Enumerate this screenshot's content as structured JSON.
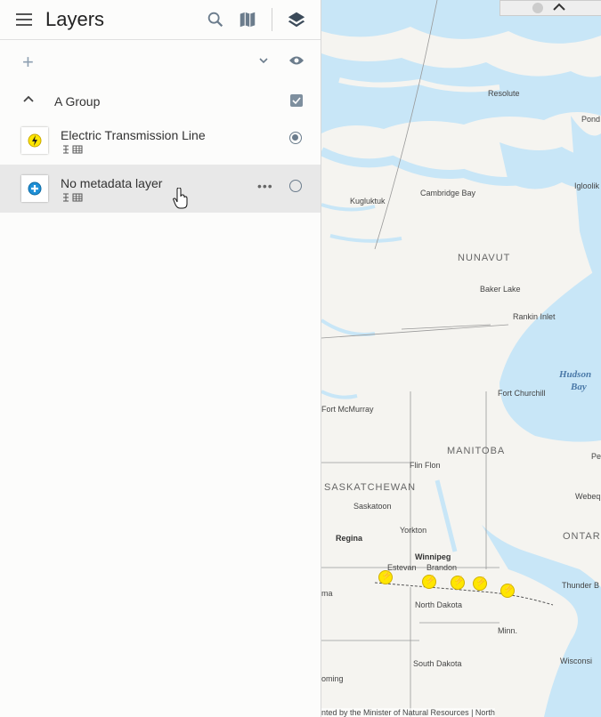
{
  "panel": {
    "title": "Layers",
    "group": {
      "label": "A Group"
    },
    "layers": [
      {
        "name": "Electric Transmission Line",
        "selected": true
      },
      {
        "name": "No metadata layer",
        "selected": false
      }
    ]
  },
  "map": {
    "places": {
      "resolute": "Resolute",
      "pond": "Pond",
      "igloolik": "Igloolik",
      "cambridge_bay": "Cambridge Bay",
      "kugluktuk": "Kugluktuk",
      "baker_lake": "Baker Lake",
      "rankin_inlet": "Rankin Inlet",
      "fort_churchill": "Fort Churchill",
      "fort_mcmurray": "Fort McMurray",
      "flin_flon": "Flin Flon",
      "saskatoon": "Saskatoon",
      "yorkton": "Yorkton",
      "regina": "Regina",
      "winnipeg": "Winnipeg",
      "estevan": "Estevan",
      "brandon": "Brandon",
      "north_dakota": "North Dakota",
      "minn": "Minn.",
      "south_dakota": "South Dakota",
      "wisconsin": "Wisconsi",
      "webeq": "Webeq",
      "thunder_bay": "Thunder B",
      "pe": "Pe",
      "ma": "ma",
      "oming": "oming"
    },
    "regions": {
      "nunavut": "NUNAVUT",
      "manitoba": "MANITOBA",
      "saskatchewan": "SASKATCHEWAN",
      "ontario": "ONTAR"
    },
    "water": {
      "hudson_bay_1": "Hudson",
      "hudson_bay_2": "Bay"
    },
    "attribution": "nted by the Minister of Natural Resources | North"
  },
  "colors": {
    "water": "#c8e6f7",
    "water_deep": "#a9d8f2",
    "land": "#f5f4f0",
    "pin": "#ffe600"
  }
}
